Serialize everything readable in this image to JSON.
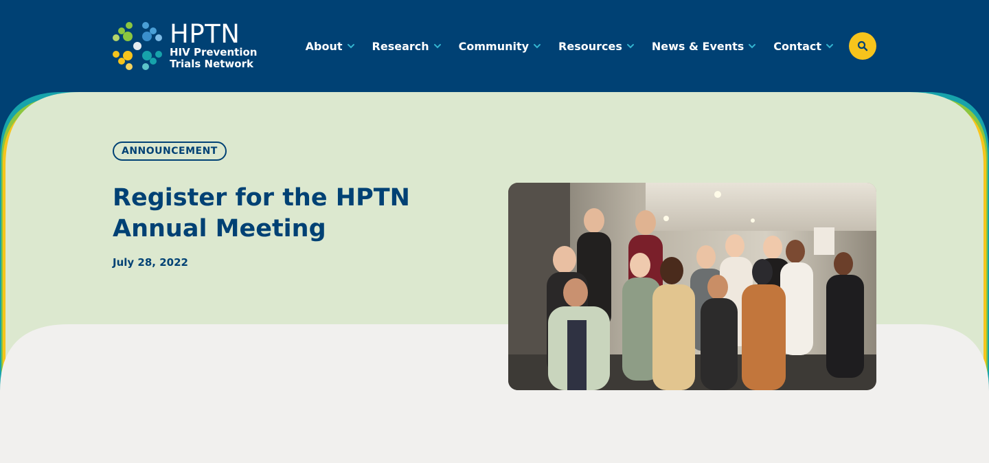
{
  "brand": {
    "abbr": "HPTN",
    "name_line1": "HIV Prevention",
    "name_line2": "Trials Network"
  },
  "nav": {
    "items": [
      {
        "label": "About"
      },
      {
        "label": "Research"
      },
      {
        "label": "Community"
      },
      {
        "label": "Resources"
      },
      {
        "label": "News & Events"
      },
      {
        "label": "Contact"
      }
    ],
    "search_icon": "search-icon"
  },
  "article": {
    "badge": "ANNOUNCEMENT",
    "title": "Register for the HPTN Annual Meeting",
    "date": "July 28, 2022"
  },
  "colors": {
    "header_bg": "#004174",
    "hero_bg": "#dce8cf",
    "page_bg": "#f1f0ee",
    "accent_yellow": "#f7c41c",
    "accent_teal": "#17a3ab",
    "accent_green": "#8cc63f",
    "chevron": "#33b4d0",
    "text_primary": "#004174"
  }
}
